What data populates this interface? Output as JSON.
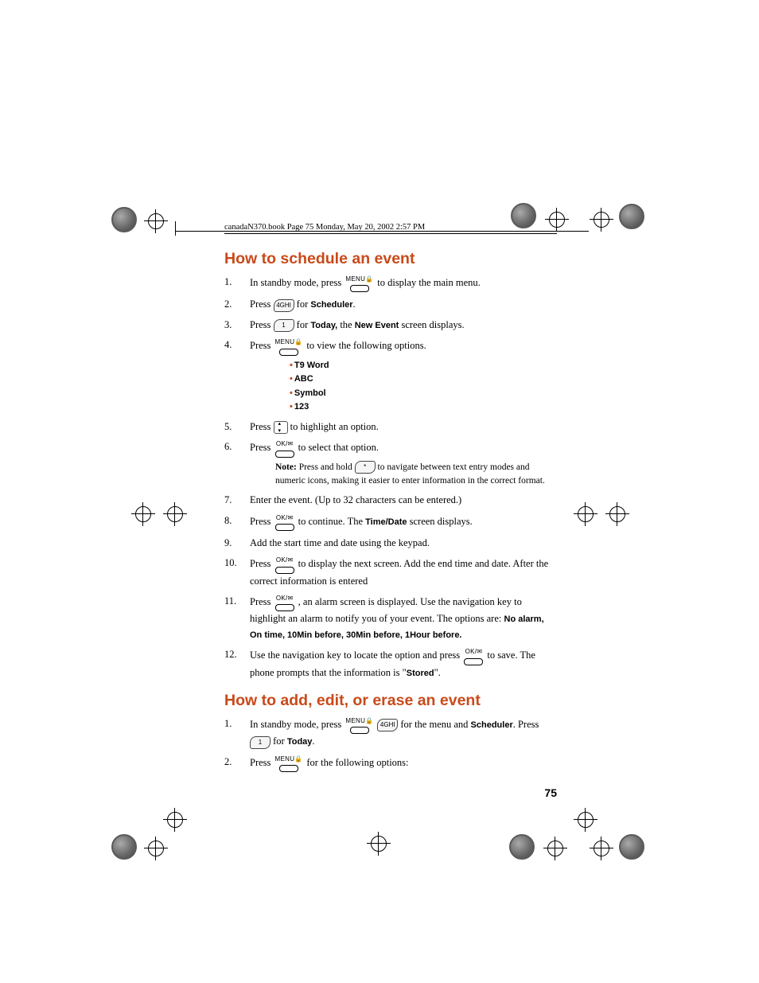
{
  "header": "canadaN370.book  Page 75  Monday, May 20, 2002  2:57 PM",
  "sec1_title": "How to schedule an event",
  "sec1": {
    "s1a": "In standby mode, press ",
    "s1b": " to display the main menu.",
    "s2a": "Press ",
    "s2b": " for ",
    "s2c": "Scheduler",
    "s2d": ".",
    "s3a": "Press ",
    "s3b": " for ",
    "s3c": "Today,",
    "s3d": " the ",
    "s3e": "New Event",
    "s3f": " screen displays.",
    "s4a": "Press ",
    "s4b": " to view the following options.",
    "bul1": "T9 Word",
    "bul2": "ABC",
    "bul3": "Symbol",
    "bul4": "123",
    "s5a": "Press ",
    "s5b": " to highlight an option.",
    "s6a": "Press ",
    "s6b": " to select that option.",
    "note_lbl": "Note:",
    "note_a": " Press and hold ",
    "note_b": " to navigate between text entry modes and numeric icons, making it easier to enter information in the correct format.",
    "s7": "Enter the event. (Up to 32 characters can be entered.)",
    "s8a": "Press ",
    "s8b": " to continue. The ",
    "s8c": "Time/Date",
    "s8d": " screen displays.",
    "s9": "Add the start time and date using the keypad.",
    "s10a": "Press ",
    "s10b": " to display the next screen. Add the end time and date. After the correct information is entered",
    "s11a": "Press ",
    "s11b": " , an alarm screen is displayed. Use the navigation key to highlight an alarm to notify you of your event. The options are: ",
    "s11c": "No alarm, On time, 10Min before, 30Min before, 1Hour before.",
    "s12a": "Use the navigation key to locate the option and press ",
    "s12b": " to save. The phone prompts that the information is \"",
    "s12c": "Stored",
    "s12d": "\"."
  },
  "sec2_title": "How to add, edit, or erase an event",
  "sec2": {
    "s1a": "In standby mode, press ",
    "s1b": " for the menu and ",
    "s1c": "Scheduler",
    "s1d": ". Press ",
    "s1e": " for ",
    "s1f": "Today",
    "s1g": ".",
    "s2a": "Press ",
    "s2b": " for the following options:"
  },
  "keys": {
    "menu": "MENU",
    "ok": "OK/",
    "four": "4GHI",
    "one": "1",
    "star": "*"
  },
  "pagenum": "75"
}
